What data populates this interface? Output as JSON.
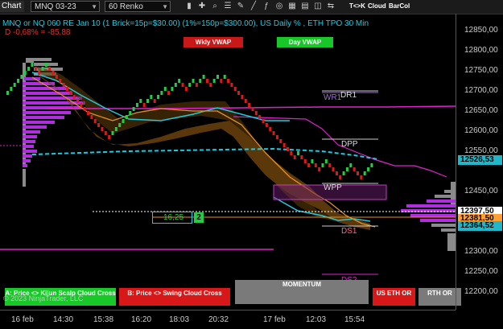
{
  "toolbar": {
    "chart_label": "Chart",
    "instrument": "MNQ 03-23",
    "bar_type": "60 Renko",
    "pills": [
      {
        "label": "T<>K",
        "color": "#e8750a"
      },
      {
        "label": "Cloud",
        "color": "#cc1a1a"
      },
      {
        "label": "BarCol",
        "color": "#e8750a"
      }
    ]
  },
  "header": {
    "title": "MNQ or NQ 060 RE Jan 10 (1 Brick=15p=$30.00) (1%=150p=$300.00), US Daily % , ETH TPO 30 Min",
    "change": "D -0,68% = -85,88"
  },
  "buttons": {
    "wkly_vwap": "Wkly VWAP",
    "day_vwap": "Day VWAP",
    "kijun_cross": "A: Price <> Kijun Scalp Cloud Cross",
    "swing_cross": "B: Price <> Swing Cloud Cross",
    "momentum": "MOMENTUM",
    "us_eth_or": "US ETH OR",
    "rth_or": "RTH OR"
  },
  "watermark": "© 2023 NinjaTrader, LLC",
  "levels": {
    "wr1": "WR1",
    "dr1": "DR1",
    "dpp": "DPP",
    "wpp": "WPP",
    "ds1": "DS1",
    "ds2": "DS2"
  },
  "counter": {
    "value": "16,25",
    "badge": "2"
  },
  "y_axis": {
    "ticks": [
      "12850,00",
      "12800,00",
      "12750,00",
      "12700,00",
      "12650,00",
      "12600,00",
      "12550,00",
      "12500,00",
      "12450,00",
      "12400,00",
      "12350,00",
      "12300,00",
      "12250,00",
      "12200,00"
    ],
    "tags": [
      {
        "label": "12526,53",
        "bg": "#20b8c8",
        "color": "#000"
      },
      {
        "label": "12397,50",
        "bg": "#ffffff",
        "color": "#000"
      },
      {
        "label": "12381,50",
        "bg": "#ffa030",
        "color": "#000"
      },
      {
        "label": "12364,52",
        "bg": "#20b8c8",
        "color": "#000"
      }
    ]
  },
  "x_axis": {
    "ticks": [
      "16 feb",
      "14:30",
      "15:38",
      "16:20",
      "18:03",
      "20:32",
      "17 feb",
      "12:03",
      "15:54"
    ]
  },
  "colors": {
    "up": "#22cc44",
    "down": "#e01818",
    "vwap_wkly": "#dd22cc",
    "cyan": "#22c8dd",
    "orange": "#e89020",
    "cloud": "#7a4a10",
    "profile": "#b02ee0"
  }
}
